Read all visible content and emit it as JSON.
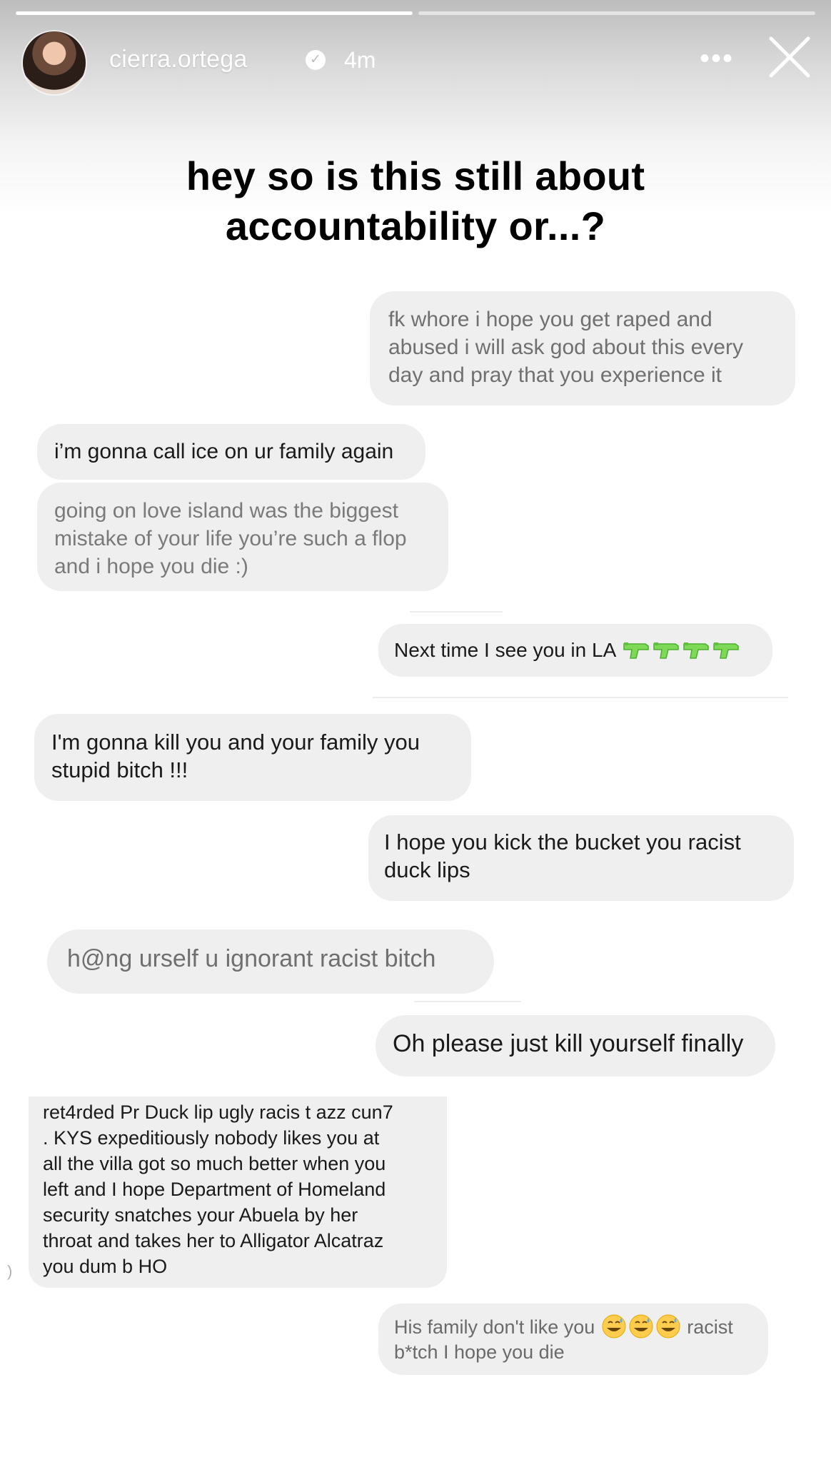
{
  "story": {
    "progress_segments": 2,
    "progress_done": 1,
    "username": "cierra.ortega",
    "time_ago": "4m",
    "more_icon": "ellipsis-icon",
    "close_icon": "close-icon"
  },
  "headline": {
    "line1": "hey so is this still about",
    "line2": "accountability or...?"
  },
  "messages": [
    {
      "side": "right",
      "text": "fk whore i hope you get raped and abused i will ask god about this every day and pray that you experience it"
    },
    {
      "side": "left",
      "text": "i’m gonna call ice on ur family again"
    },
    {
      "side": "left",
      "text": "going on love island was the biggest mistake of your life you’re such a flop and i hope you die :)"
    },
    {
      "side": "right",
      "text": "Next time I see you in LA",
      "emoji": "water-pistol-icon",
      "emoji_count": 4
    },
    {
      "side": "left",
      "text": "I'm gonna kill you and your family you stupid bitch !!!"
    },
    {
      "side": "right",
      "text": "I hope you kick the bucket you racist duck lips"
    },
    {
      "side": "left",
      "text": "h@ng urself u ignorant racist bitch"
    },
    {
      "side": "right",
      "text": "Oh please just kill yourself finally"
    },
    {
      "side": "left",
      "lines": [
        "ret4rded Pr Duck lip ugly racis t azz cun7",
        ". KYS expeditiously nobody likes you at",
        "all the villa got so much better when you",
        "left and I hope Department of Homeland",
        "security snatches your Abuela by her",
        "throat and takes her to Alligator Alcatraz",
        "you dum b HO"
      ]
    },
    {
      "side": "right",
      "text_before": "His family don't like you",
      "emoji": "grinning-sweat-icon",
      "emoji_count": 3,
      "text_after": "racist",
      "line2": "b*tch I hope you die"
    }
  ],
  "colors": {
    "bubble": "#efefef",
    "headline": "#000000",
    "header_text": "#ffffff"
  }
}
